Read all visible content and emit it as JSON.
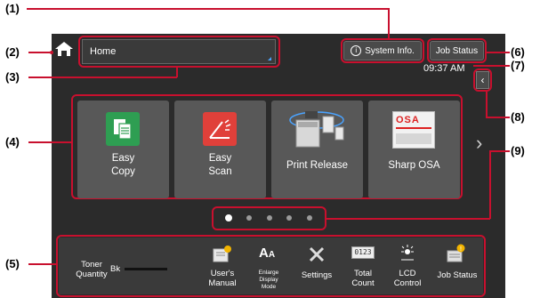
{
  "callouts": [
    "(1)",
    "(2)",
    "(3)",
    "(4)",
    "(5)",
    "(6)",
    "(7)",
    "(8)",
    "(9)"
  ],
  "header": {
    "home_select": "Home",
    "system_info": "System Info.",
    "job_status": "Job Status",
    "time": "09:37 AM"
  },
  "apps": [
    {
      "l1": "Easy",
      "l2": "Copy"
    },
    {
      "l1": "Easy",
      "l2": "Scan"
    },
    {
      "l1": "Print Release"
    },
    {
      "l1": "Sharp OSA"
    }
  ],
  "pager": {
    "pages": 5,
    "current": 1
  },
  "bottom": {
    "toner_label_1": "Toner",
    "toner_label_2": "Quantity",
    "toner_bk": "Bk",
    "items": [
      {
        "l1": "User's",
        "l2": "Manual",
        "icon": "book-icon"
      },
      {
        "l1": "Enlarge",
        "l2": "Display",
        "l3": "Mode",
        "icon": "enlarge-text-icon"
      },
      {
        "l1": "Settings",
        "icon": "settings-tools-icon"
      },
      {
        "l1": "Total",
        "l2": "Count",
        "icon": "counter-icon"
      },
      {
        "l1": "LCD",
        "l2": "Control",
        "icon": "brightness-icon"
      },
      {
        "l1": "Job Status",
        "icon": "job-status-icon"
      }
    ],
    "total_count_display": "0123"
  },
  "osa_logo": "OSA",
  "colors": {
    "callout": "#c8102e",
    "screen_bg": "#2b2b2b",
    "tile_bg": "#585858",
    "copy_green": "#2e9e52",
    "scan_red": "#e0403a"
  }
}
